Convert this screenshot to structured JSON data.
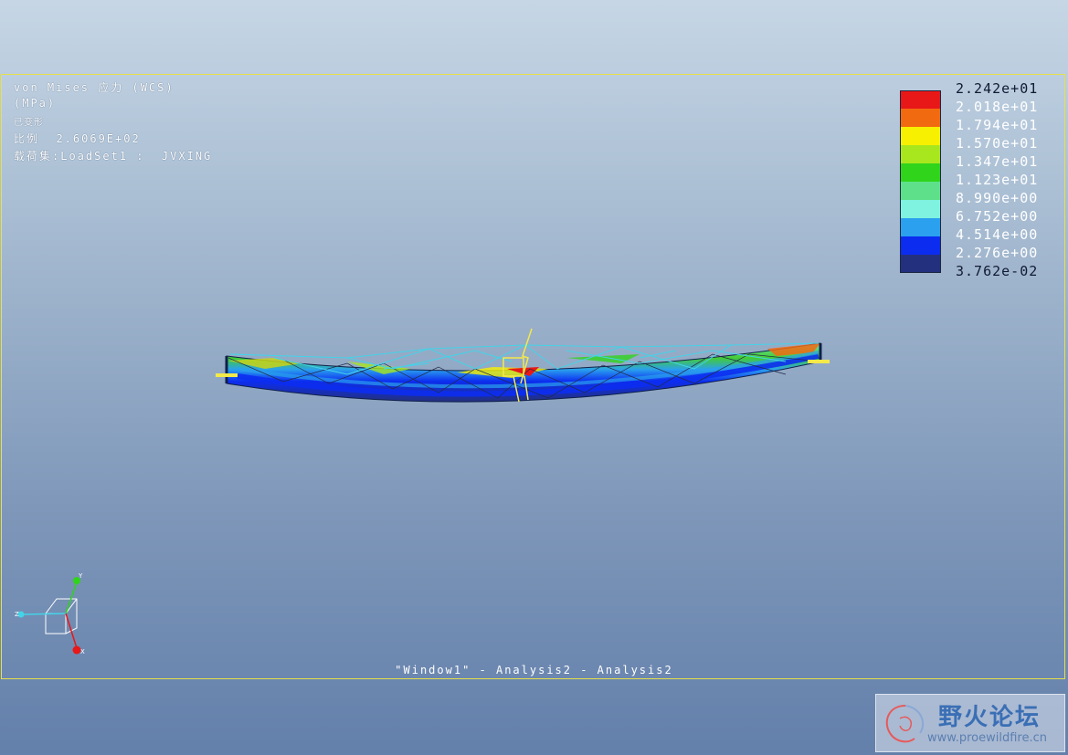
{
  "info": {
    "result_type": "von Mises 应力 (WCS)",
    "units": "(MPa)",
    "deformed": "已变形",
    "scale": "比例  2.6069E+02",
    "load_set": "载荷集:LoadSet1 :  JVXING"
  },
  "legend": {
    "labels": [
      "2.242e+01",
      "2.018e+01",
      "1.794e+01",
      "1.570e+01",
      "1.347e+01",
      "1.123e+01",
      "8.990e+00",
      "6.752e+00",
      "4.514e+00",
      "2.276e+00",
      "3.762e-02"
    ],
    "colors": [
      "#e81818",
      "#f26a10",
      "#f7f000",
      "#a8e61e",
      "#2fd41b",
      "#5ee08a",
      "#7ff2e0",
      "#2aa0ee",
      "#0c2df0",
      "#23307e"
    ]
  },
  "caption": "\"Window1\" - Analysis2 - Analysis2",
  "axes": {
    "x_label": "X",
    "y_label": "Y",
    "z_label": "Z"
  },
  "watermark": {
    "title": "野火论坛",
    "url": "www.proewildfire.cn"
  }
}
